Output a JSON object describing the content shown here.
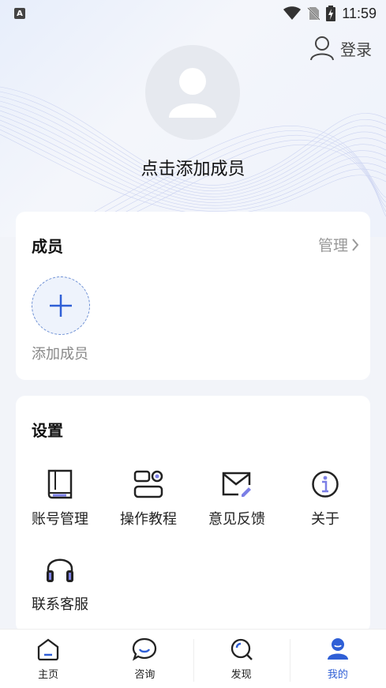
{
  "status_bar": {
    "time": "11:59",
    "app_icon_letter": "A"
  },
  "header": {
    "login_label": "登录",
    "add_member_title": "点击添加成员"
  },
  "members": {
    "title": "成员",
    "manage_label": "管理",
    "add_label": "添加成员"
  },
  "settings": {
    "title": "设置",
    "items": [
      {
        "label": "账号管理",
        "icon": "book-icon"
      },
      {
        "label": "操作教程",
        "icon": "tutorial-icon"
      },
      {
        "label": "意见反馈",
        "icon": "feedback-mail-icon"
      },
      {
        "label": "关于",
        "icon": "info-icon"
      },
      {
        "label": "联系客服",
        "icon": "headphones-icon"
      }
    ]
  },
  "tabbar": {
    "tabs": [
      {
        "label": "主页",
        "icon": "home-icon"
      },
      {
        "label": "咨询",
        "icon": "chat-icon"
      },
      {
        "label": "发现",
        "icon": "discover-icon"
      },
      {
        "label": "我的",
        "icon": "profile-icon"
      }
    ],
    "active_index": 3
  },
  "colors": {
    "accent": "#2f5fd6",
    "icon_accent": "#7b7fe6",
    "page_bg": "#f2f4f9"
  }
}
